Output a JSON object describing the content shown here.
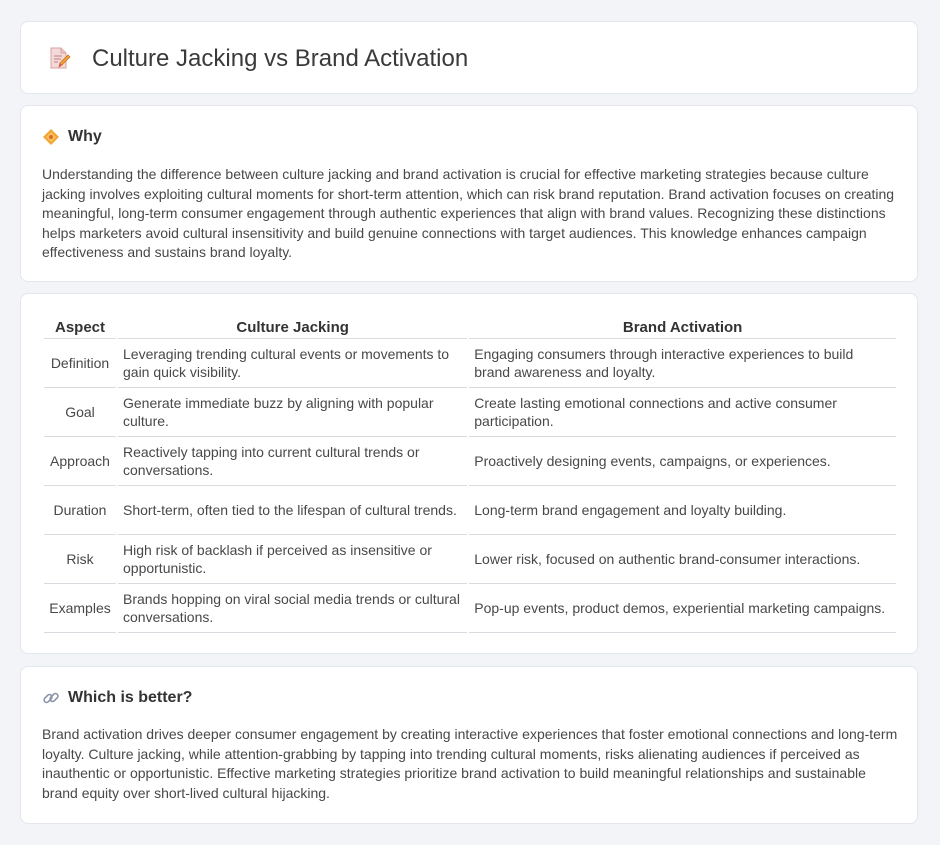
{
  "header": {
    "title": "Culture Jacking vs Brand Activation"
  },
  "why": {
    "heading": "Why",
    "text": "Understanding the difference between culture jacking and brand activation is crucial for effective marketing strategies because culture jacking involves exploiting cultural moments for short-term attention, which can risk brand reputation. Brand activation focuses on creating meaningful, long-term consumer engagement through authentic experiences that align with brand values. Recognizing these distinctions helps marketers avoid cultural insensitivity and build genuine connections with target audiences. This knowledge enhances campaign effectiveness and sustains brand loyalty."
  },
  "comparison": {
    "headers": [
      "Aspect",
      "Culture Jacking",
      "Brand Activation"
    ],
    "rows": [
      [
        "Definition",
        "Leveraging trending cultural events or movements to gain quick visibility.",
        "Engaging consumers through interactive experiences to build brand awareness and loyalty."
      ],
      [
        "Goal",
        "Generate immediate buzz by aligning with popular culture.",
        "Create lasting emotional connections and active consumer participation."
      ],
      [
        "Approach",
        "Reactively tapping into current cultural trends or conversations.",
        "Proactively designing events, campaigns, or experiences."
      ],
      [
        "Duration",
        "Short-term, often tied to the lifespan of cultural trends.",
        "Long-term brand engagement and loyalty building."
      ],
      [
        "Risk",
        "High risk of backlash if perceived as insensitive or opportunistic.",
        "Lower risk, focused on authentic brand-consumer interactions."
      ],
      [
        "Examples",
        "Brands hopping on viral social media trends or cultural conversations.",
        "Pop-up events, product demos, experiential marketing campaigns."
      ]
    ]
  },
  "better": {
    "heading": "Which is better?",
    "text": "Brand activation drives deeper consumer engagement by creating interactive experiences that foster emotional connections and long-term loyalty. Culture jacking, while attention-grabbing by tapping into trending cultural moments, risks alienating audiences if perceived as inauthentic or opportunistic. Effective marketing strategies prioritize brand activation to build meaningful relationships and sustainable brand equity over short-lived cultural hijacking."
  }
}
